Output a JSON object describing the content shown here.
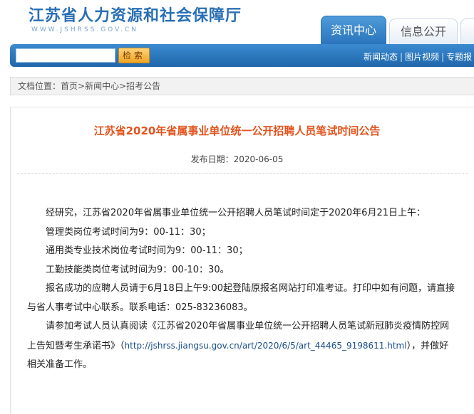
{
  "site": {
    "title": "江苏省人力资源和社会保障厅",
    "subtitle": "WWW.JSHRSS.GOV.CN"
  },
  "tabs": [
    {
      "label": "资讯中心",
      "active": true
    },
    {
      "label": "信息公开",
      "active": false
    }
  ],
  "search": {
    "value": "",
    "placeholder": "",
    "button_label": "检索"
  },
  "quick_links": [
    "新闻动态",
    "图片视频",
    "专题报"
  ],
  "breadcrumb": {
    "prefix": "文档位置：",
    "items": [
      "首页",
      "新闻中心",
      "招考公告"
    ],
    "separator": ">"
  },
  "article": {
    "title": "江苏省2020年省属事业单位统一公开招聘人员笔试时间公告",
    "date_label": "发布日期：",
    "date": "2020-06-05",
    "para1": "经研究，江苏省2020年省属事业单位统一公开招聘人员笔试时间定于2020年6月21日上午：",
    "item1": "管理类岗位考试时间为9：00-11：30；",
    "item2": "通用类专业技术岗位考试时间为9：00-11：30；",
    "item3": "工勤技能类岗位考试时间为9：00-10：30。",
    "para2": "报名成功的应聘人员请于6月18日上午9:00起登陆原报名网站打印准考证。打印中如有问题，请直接与省人事考试中心联系。联系电话：025-83236083。",
    "para3_before": "请参加考试人员认真阅读《江苏省2020年省属事业单位统一公开招聘人员笔试新冠肺炎疫情防控网上告知暨考生承诺书》（",
    "para3_link": "http://jshrss.jiangsu.gov.cn/art/2020/6/5/art_44465_9198611.html",
    "para3_after": "），并做好相关准备工作。"
  },
  "colors": {
    "brand_blue": "#2a6fb5",
    "nav_blue": "#2a75bd",
    "title_orange": "#e4531d",
    "search_button": "#f0a424"
  }
}
